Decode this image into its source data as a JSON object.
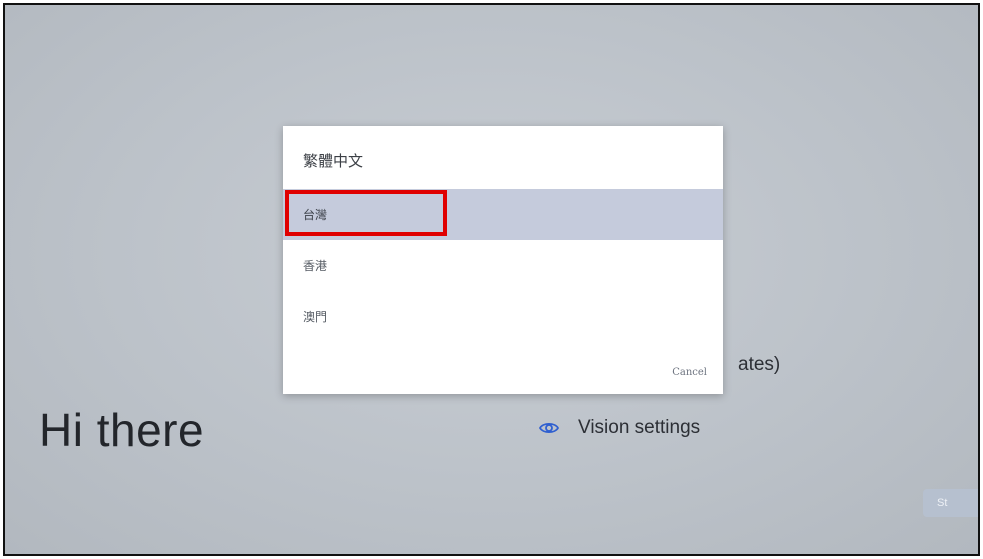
{
  "background": {
    "greeting": "Hi there",
    "partial_option_text": "ates)",
    "vision_option": {
      "icon": "eye-icon",
      "label": "Vision settings"
    },
    "next_button_label": "St"
  },
  "dialog": {
    "title": "繁體中文",
    "options": [
      {
        "label": "台灣",
        "selected": true
      },
      {
        "label": "香港",
        "selected": false
      },
      {
        "label": "澳門",
        "selected": false
      }
    ],
    "cancel_label": "Cancel"
  },
  "colors": {
    "selected_row": "#c5cbdc",
    "highlight_box": "#e00000",
    "eye_icon": "#2f5fd0"
  }
}
